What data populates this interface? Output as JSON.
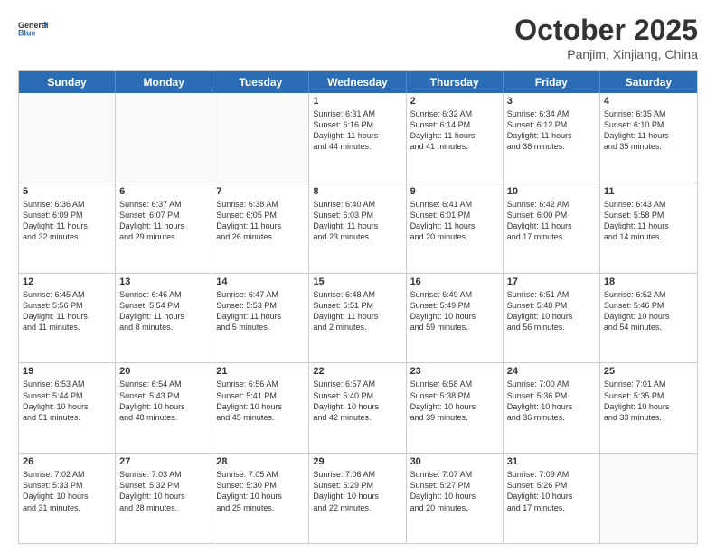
{
  "logo": {
    "line1": "General",
    "line2": "Blue"
  },
  "header": {
    "month": "October 2025",
    "location": "Panjim, Xinjiang, China"
  },
  "days": [
    "Sunday",
    "Monday",
    "Tuesday",
    "Wednesday",
    "Thursday",
    "Friday",
    "Saturday"
  ],
  "weeks": [
    [
      {
        "day": "",
        "content": ""
      },
      {
        "day": "",
        "content": ""
      },
      {
        "day": "",
        "content": ""
      },
      {
        "day": "1",
        "content": "Sunrise: 6:31 AM\nSunset: 6:16 PM\nDaylight: 11 hours\nand 44 minutes."
      },
      {
        "day": "2",
        "content": "Sunrise: 6:32 AM\nSunset: 6:14 PM\nDaylight: 11 hours\nand 41 minutes."
      },
      {
        "day": "3",
        "content": "Sunrise: 6:34 AM\nSunset: 6:12 PM\nDaylight: 11 hours\nand 38 minutes."
      },
      {
        "day": "4",
        "content": "Sunrise: 6:35 AM\nSunset: 6:10 PM\nDaylight: 11 hours\nand 35 minutes."
      }
    ],
    [
      {
        "day": "5",
        "content": "Sunrise: 6:36 AM\nSunset: 6:09 PM\nDaylight: 11 hours\nand 32 minutes."
      },
      {
        "day": "6",
        "content": "Sunrise: 6:37 AM\nSunset: 6:07 PM\nDaylight: 11 hours\nand 29 minutes."
      },
      {
        "day": "7",
        "content": "Sunrise: 6:38 AM\nSunset: 6:05 PM\nDaylight: 11 hours\nand 26 minutes."
      },
      {
        "day": "8",
        "content": "Sunrise: 6:40 AM\nSunset: 6:03 PM\nDaylight: 11 hours\nand 23 minutes."
      },
      {
        "day": "9",
        "content": "Sunrise: 6:41 AM\nSunset: 6:01 PM\nDaylight: 11 hours\nand 20 minutes."
      },
      {
        "day": "10",
        "content": "Sunrise: 6:42 AM\nSunset: 6:00 PM\nDaylight: 11 hours\nand 17 minutes."
      },
      {
        "day": "11",
        "content": "Sunrise: 6:43 AM\nSunset: 5:58 PM\nDaylight: 11 hours\nand 14 minutes."
      }
    ],
    [
      {
        "day": "12",
        "content": "Sunrise: 6:45 AM\nSunset: 5:56 PM\nDaylight: 11 hours\nand 11 minutes."
      },
      {
        "day": "13",
        "content": "Sunrise: 6:46 AM\nSunset: 5:54 PM\nDaylight: 11 hours\nand 8 minutes."
      },
      {
        "day": "14",
        "content": "Sunrise: 6:47 AM\nSunset: 5:53 PM\nDaylight: 11 hours\nand 5 minutes."
      },
      {
        "day": "15",
        "content": "Sunrise: 6:48 AM\nSunset: 5:51 PM\nDaylight: 11 hours\nand 2 minutes."
      },
      {
        "day": "16",
        "content": "Sunrise: 6:49 AM\nSunset: 5:49 PM\nDaylight: 10 hours\nand 59 minutes."
      },
      {
        "day": "17",
        "content": "Sunrise: 6:51 AM\nSunset: 5:48 PM\nDaylight: 10 hours\nand 56 minutes."
      },
      {
        "day": "18",
        "content": "Sunrise: 6:52 AM\nSunset: 5:46 PM\nDaylight: 10 hours\nand 54 minutes."
      }
    ],
    [
      {
        "day": "19",
        "content": "Sunrise: 6:53 AM\nSunset: 5:44 PM\nDaylight: 10 hours\nand 51 minutes."
      },
      {
        "day": "20",
        "content": "Sunrise: 6:54 AM\nSunset: 5:43 PM\nDaylight: 10 hours\nand 48 minutes."
      },
      {
        "day": "21",
        "content": "Sunrise: 6:56 AM\nSunset: 5:41 PM\nDaylight: 10 hours\nand 45 minutes."
      },
      {
        "day": "22",
        "content": "Sunrise: 6:57 AM\nSunset: 5:40 PM\nDaylight: 10 hours\nand 42 minutes."
      },
      {
        "day": "23",
        "content": "Sunrise: 6:58 AM\nSunset: 5:38 PM\nDaylight: 10 hours\nand 39 minutes."
      },
      {
        "day": "24",
        "content": "Sunrise: 7:00 AM\nSunset: 5:36 PM\nDaylight: 10 hours\nand 36 minutes."
      },
      {
        "day": "25",
        "content": "Sunrise: 7:01 AM\nSunset: 5:35 PM\nDaylight: 10 hours\nand 33 minutes."
      }
    ],
    [
      {
        "day": "26",
        "content": "Sunrise: 7:02 AM\nSunset: 5:33 PM\nDaylight: 10 hours\nand 31 minutes."
      },
      {
        "day": "27",
        "content": "Sunrise: 7:03 AM\nSunset: 5:32 PM\nDaylight: 10 hours\nand 28 minutes."
      },
      {
        "day": "28",
        "content": "Sunrise: 7:05 AM\nSunset: 5:30 PM\nDaylight: 10 hours\nand 25 minutes."
      },
      {
        "day": "29",
        "content": "Sunrise: 7:06 AM\nSunset: 5:29 PM\nDaylight: 10 hours\nand 22 minutes."
      },
      {
        "day": "30",
        "content": "Sunrise: 7:07 AM\nSunset: 5:27 PM\nDaylight: 10 hours\nand 20 minutes."
      },
      {
        "day": "31",
        "content": "Sunrise: 7:09 AM\nSunset: 5:26 PM\nDaylight: 10 hours\nand 17 minutes."
      },
      {
        "day": "",
        "content": ""
      }
    ]
  ]
}
